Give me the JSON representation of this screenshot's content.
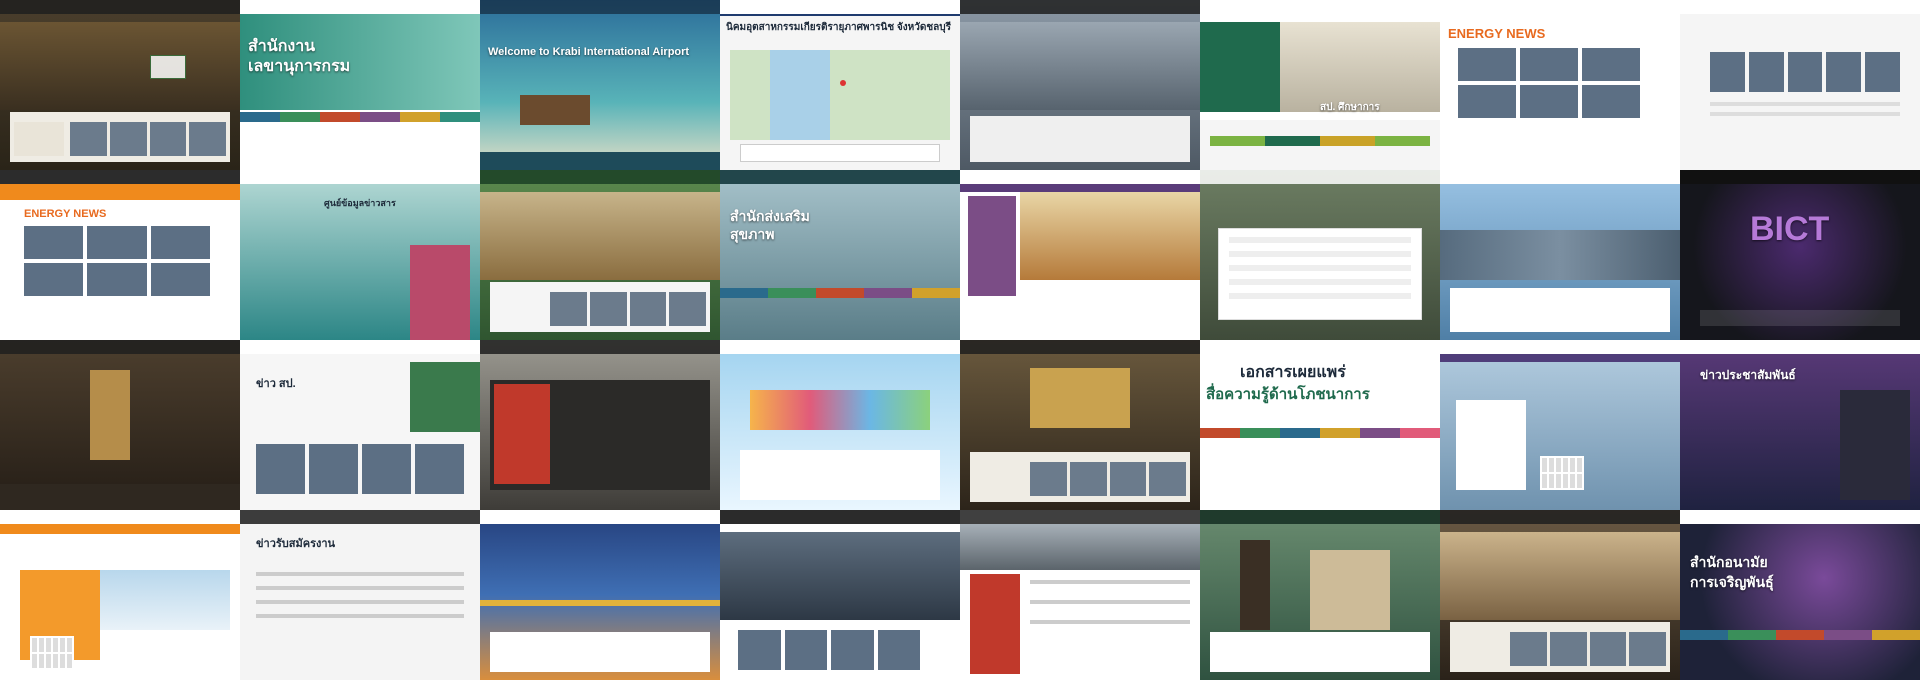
{
  "tiles": [
    {
      "id": "t01",
      "caption": "",
      "theme": "dark-gov-rural",
      "bg": "#3d3428"
    },
    {
      "id": "t02",
      "caption": "สำนักงาน",
      "caption2": "เลขานุการกรม",
      "theme": "green-teal",
      "bg": "#2a8a7e"
    },
    {
      "id": "t03",
      "caption": "Welcome to Krabi International Airport",
      "theme": "beach",
      "bg": "#2f7c8e"
    },
    {
      "id": "t04",
      "caption": "นิคมอุตสาหกรรมเกียรติรายุภาศพารนิช จังหวัดชลบุรี",
      "theme": "map",
      "bg": "#f3f3f3"
    },
    {
      "id": "t05",
      "caption": "",
      "theme": "port-city",
      "bg": "#6a7480"
    },
    {
      "id": "t06",
      "caption": "สป. ศึกษาการ",
      "theme": "green-officer",
      "bg": "#1f6a4d"
    },
    {
      "id": "t07",
      "caption": "ENERGY NEWS",
      "theme": "energy",
      "bg": "#ffffff"
    },
    {
      "id": "t08",
      "caption": "",
      "theme": "white-news",
      "bg": "#f4f4f4"
    },
    {
      "id": "t09",
      "caption": "ENERGY NEWS",
      "theme": "energy-orange",
      "bg": "#ffffff"
    },
    {
      "id": "t10",
      "caption": "ศูนย์ข้อมูลข่าวสาร",
      "theme": "teal-lady",
      "bg": "#2c8686"
    },
    {
      "id": "t11",
      "caption": "",
      "theme": "green-temple",
      "bg": "#3c6a3a"
    },
    {
      "id": "t12",
      "caption": "สำนักส่งเสริม",
      "caption2": "สุขภาพ",
      "theme": "building",
      "bg": "#6d8f9a"
    },
    {
      "id": "t13",
      "caption": "",
      "theme": "purple-temple",
      "bg": "#7b4d86"
    },
    {
      "id": "t14",
      "caption": "",
      "theme": "form",
      "bg": "#efefef"
    },
    {
      "id": "t15",
      "caption": "",
      "theme": "city",
      "bg": "#5f8db3"
    },
    {
      "id": "t16",
      "caption": "BICT",
      "theme": "bict-dark",
      "bg": "#15161c"
    },
    {
      "id": "t17",
      "caption": "",
      "theme": "dark-statue",
      "bg": "#3b3229"
    },
    {
      "id": "t18",
      "caption": "ข่าว สป.",
      "theme": "white-nav",
      "bg": "#f6f6f6"
    },
    {
      "id": "t19",
      "caption": "",
      "theme": "solar",
      "bg": "#4c4a46"
    },
    {
      "id": "t20",
      "caption": "",
      "theme": "kids",
      "bg": "#8fc7e8"
    },
    {
      "id": "t21",
      "caption": "",
      "theme": "temple-night",
      "bg": "#4a3f30"
    },
    {
      "id": "t22",
      "caption": "เอกสารเผยแพร่",
      "caption2": "สื่อความรู้ด้านโภชนาการ",
      "theme": "nutrition",
      "bg": "#f2f2f2"
    },
    {
      "id": "t23",
      "caption": "",
      "theme": "khonkaen",
      "bg": "#5b88ad"
    },
    {
      "id": "t24",
      "caption": "ข่าวประชาสัมพันธ์",
      "theme": "purple-leader",
      "bg": "#6a3b8a"
    },
    {
      "id": "t25",
      "caption": "",
      "theme": "dca",
      "bg": "#f39a2b"
    },
    {
      "id": "t26",
      "caption": "ข่าวรับสมัครงาน",
      "theme": "jobs",
      "bg": "#f4f4f4"
    },
    {
      "id": "t27",
      "caption": "",
      "theme": "bridge",
      "bg": "#2b4f8d"
    },
    {
      "id": "t28",
      "caption": "",
      "theme": "bict-white",
      "bg": "#f6f6f6"
    },
    {
      "id": "t29",
      "caption": "",
      "theme": "solar-red",
      "bg": "#ffffff"
    },
    {
      "id": "t30",
      "caption": "",
      "theme": "statue-green",
      "bg": "#3f6a4b"
    },
    {
      "id": "t31",
      "caption": "",
      "theme": "beach-news",
      "bg": "#4a4033"
    },
    {
      "id": "t32",
      "caption": "สำนักอนามัย",
      "caption2": "การเจริญพันธุ์",
      "theme": "bio",
      "bg": "#2a2f4b"
    }
  ]
}
